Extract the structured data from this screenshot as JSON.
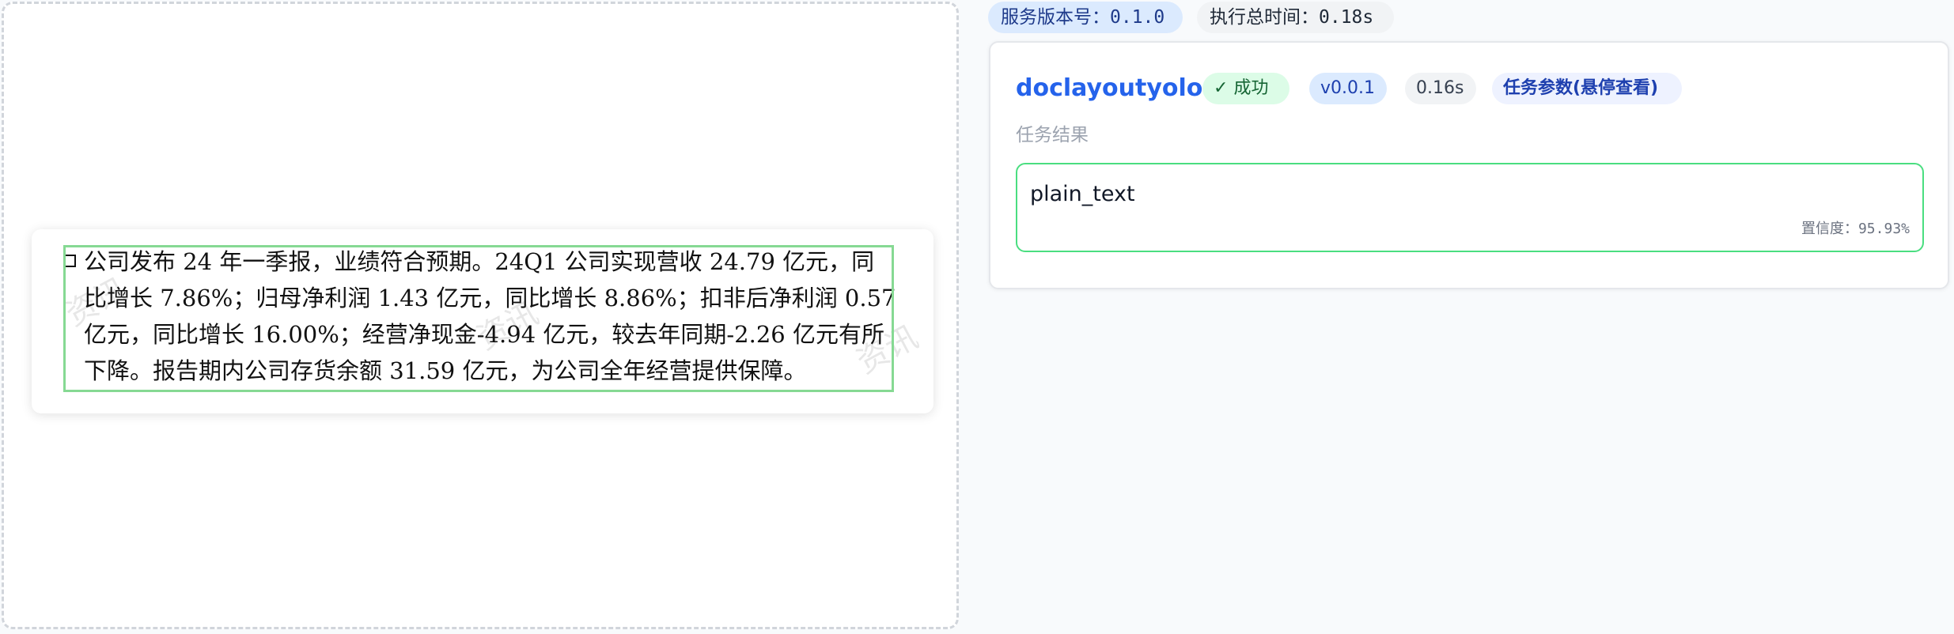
{
  "header": {
    "service_version_label": "服务版本号：",
    "service_version": "0.1.0",
    "total_time_label": "执行总时间：",
    "total_time": "0.18s"
  },
  "document": {
    "lines": [
      "公司发布 24 年一季报，业绩符合预期。24Q1 公司实现营收 24.79 亿元，同",
      "比增长 7.86%；归母净利润 1.43 亿元，同比增长 8.86%；扣非后净利润 0.57",
      "亿元，同比增长 16.00%；经营净现金-4.94 亿元，较去年同期-2.26 亿元有所",
      "下降。报告期内公司存货余额 31.59 亿元，为公司全年经营提供保障。"
    ],
    "watermark": "资讯"
  },
  "task": {
    "name": "doclayoutyolo",
    "status_icon": "check-icon",
    "status": "成功",
    "version": "v0.0.1",
    "duration": "0.16s",
    "params_label": "任务参数(悬停查看)",
    "result_section_label": "任务结果",
    "result_label": "plain_text",
    "confidence_label": "置信度：",
    "confidence": "95.93%"
  },
  "colors": {
    "accent": "#2563eb",
    "success_border": "#4ade80",
    "layout_box": "#86d993"
  }
}
